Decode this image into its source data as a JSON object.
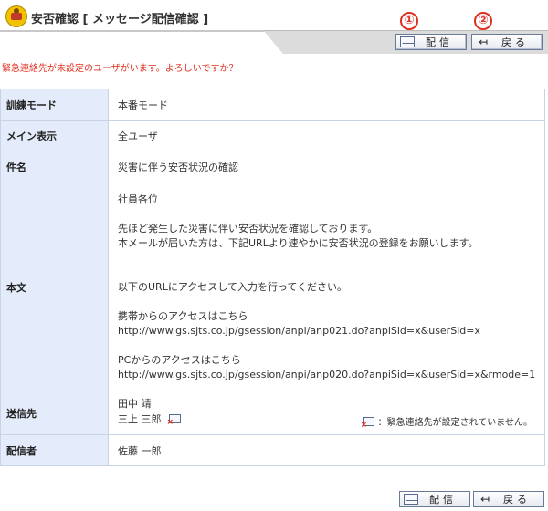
{
  "header": {
    "title": "安否確認 [ メッセージ配信確認 ]"
  },
  "toolbar": {
    "send_label": "配信",
    "back_label": "戻る",
    "badge_1": "①",
    "badge_2": "②"
  },
  "warning": "緊急連絡先が未設定のユーザがいます。よろしいですか？",
  "details": {
    "mode": {
      "label": "訓練モード",
      "value": "本番モード"
    },
    "main_display": {
      "label": "メイン表示",
      "value": "全ユーザ"
    },
    "subject": {
      "label": "件名",
      "value": "災害に伴う安否状況の確認"
    },
    "body": {
      "label": "本文",
      "lines": [
        "社員各位",
        "",
        "先ほど発生した災害に伴い安否状況を確認しております。",
        "本メールが届いた方は、下記URLより速やかに安否状況の登録をお願いします。",
        "",
        "",
        "以下のURLにアクセスして入力を行ってください。",
        "",
        "携帯からのアクセスはこちら",
        "http://www.gs.sjts.co.jp/gsession/anpi/anp021.do?anpiSid=x&userSid=x",
        "",
        "PCからのアクセスはこちら",
        "http://www.gs.sjts.co.jp/gsession/anpi/anp020.do?anpiSid=x&userSid=x&rmode=1"
      ]
    },
    "recipients": {
      "label": "送信先",
      "users": [
        "田中 靖",
        "三上 三郎"
      ],
      "legend": "：緊急連絡先が設定されていません。"
    },
    "sender": {
      "label": "配信者",
      "value": "佐藤 一郎"
    }
  },
  "colors": {
    "accent_red": "#e03020",
    "label_bg": "#e4ecfb",
    "border": "#c9d3e6"
  },
  "icons": {
    "send": "envelope-icon",
    "back": "back-arrow-icon",
    "logo": "app-logo-icon",
    "no_contact": "no-email-icon"
  }
}
